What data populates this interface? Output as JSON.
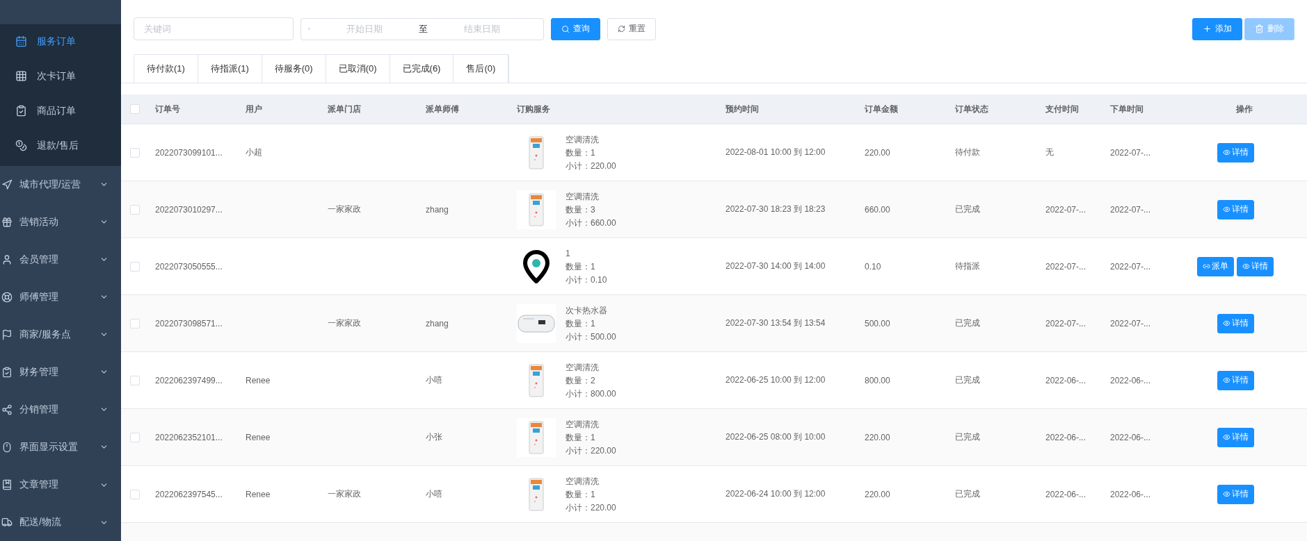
{
  "sidebar": {
    "submenu": [
      {
        "label": "服务订单",
        "selected": true
      },
      {
        "label": "次卡订单",
        "selected": false
      },
      {
        "label": "商品订单",
        "selected": false
      },
      {
        "label": "退款/售后",
        "selected": false
      }
    ],
    "items": [
      {
        "label": "城市代理/运营"
      },
      {
        "label": "营销活动"
      },
      {
        "label": "会员管理"
      },
      {
        "label": "师傅管理"
      },
      {
        "label": "商家/服务点"
      },
      {
        "label": "财务管理"
      },
      {
        "label": "分销管理"
      },
      {
        "label": "界面显示设置"
      },
      {
        "label": "文章管理"
      },
      {
        "label": "配送/物流"
      }
    ]
  },
  "filters": {
    "keyword": {
      "placeholder": "关键词"
    },
    "date_range": {
      "start_placeholder": "开始日期",
      "separator": "至",
      "end_placeholder": "结束日期"
    },
    "search_button": "查询",
    "reset_button": "重置"
  },
  "actions": [
    {
      "label": "添加",
      "kind": "add",
      "disabled": false
    },
    {
      "label": "删除",
      "kind": "delete",
      "disabled": true
    }
  ],
  "tabs": [
    {
      "label": "待付款(1)",
      "selected": false
    },
    {
      "label": "待指派(1)",
      "selected": false
    },
    {
      "label": "待服务(0)",
      "selected": false
    },
    {
      "label": "已取消(0)",
      "selected": false
    },
    {
      "label": "已完成(6)",
      "selected": false
    },
    {
      "label": "售后(0)",
      "selected": false
    }
  ],
  "table": {
    "select_all": {
      "checked": false
    },
    "columns": [
      "订单号",
      "用户",
      "派单门店",
      "派单师傅",
      "订购服务",
      "预约时间",
      "订单金额",
      "订单状态",
      "支付时间",
      "下单时间",
      "操作"
    ],
    "rows": [
      {
        "checked": false,
        "order_no": "2022073099101...",
        "user": "小超",
        "store": "",
        "worker": "",
        "service": {
          "kind": "ac",
          "name": "空调清洗",
          "qty": "数量：1",
          "subtotal": "小计：220.00"
        },
        "appointment": "2022-08-01 10:00 到 12:00",
        "amount": "220.00",
        "status": "待付款",
        "pay_time": "无",
        "order_time": "2022-07-...",
        "buttons": [
          {
            "kind": "detail",
            "label": "详情"
          }
        ]
      },
      {
        "checked": false,
        "order_no": "2022073010297...",
        "user": "",
        "store": "一家家政",
        "worker": "zhang",
        "service": {
          "kind": "ac",
          "name": "空调清洗",
          "qty": "数量：3",
          "subtotal": "小计：660.00"
        },
        "appointment": "2022-07-30 18:23 到 18:23",
        "amount": "660.00",
        "status": "已完成",
        "pay_time": "2022-07-...",
        "order_time": "2022-07-...",
        "buttons": [
          {
            "kind": "detail",
            "label": "详情"
          }
        ]
      },
      {
        "checked": false,
        "order_no": "2022073050555...",
        "user": "",
        "store": "",
        "worker": "",
        "service": {
          "kind": "pin",
          "name": "1",
          "qty": "数量：1",
          "subtotal": "小计：0.10"
        },
        "appointment": "2022-07-30 14:00 到 14:00",
        "amount": "0.10",
        "status": "待指派",
        "pay_time": "2022-07-...",
        "order_time": "2022-07-...",
        "buttons": [
          {
            "kind": "dispatch",
            "label": "派单"
          },
          {
            "kind": "detail",
            "label": "详情"
          }
        ]
      },
      {
        "checked": false,
        "order_no": "2022073098571...",
        "user": "",
        "store": "一家家政",
        "worker": "zhang",
        "service": {
          "kind": "heater",
          "name": "次卡热水器",
          "qty": "数量：1",
          "subtotal": "小计：500.00"
        },
        "appointment": "2022-07-30 13:54 到 13:54",
        "amount": "500.00",
        "status": "已完成",
        "pay_time": "2022-07-...",
        "order_time": "2022-07-...",
        "buttons": [
          {
            "kind": "detail",
            "label": "详情"
          }
        ]
      },
      {
        "checked": false,
        "order_no": "2022062397499...",
        "user": "Renee",
        "store": "",
        "worker": "小嘻",
        "service": {
          "kind": "ac",
          "name": "空调清洗",
          "qty": "数量：2",
          "subtotal": "小计：800.00"
        },
        "appointment": "2022-06-25 10:00 到 12:00",
        "amount": "800.00",
        "status": "已完成",
        "pay_time": "2022-06-...",
        "order_time": "2022-06-...",
        "buttons": [
          {
            "kind": "detail",
            "label": "详情"
          }
        ]
      },
      {
        "checked": false,
        "order_no": "2022062352101...",
        "user": "Renee",
        "store": "",
        "worker": "小张",
        "service": {
          "kind": "ac",
          "name": "空调清洗",
          "qty": "数量：1",
          "subtotal": "小计：220.00"
        },
        "appointment": "2022-06-25 08:00 到 10:00",
        "amount": "220.00",
        "status": "已完成",
        "pay_time": "2022-06-...",
        "order_time": "2022-06-...",
        "buttons": [
          {
            "kind": "detail",
            "label": "详情"
          }
        ]
      },
      {
        "checked": false,
        "order_no": "2022062397545...",
        "user": "Renee",
        "store": "一家家政",
        "worker": "小嘻",
        "service": {
          "kind": "ac",
          "name": "空调清洗",
          "qty": "数量：1",
          "subtotal": "小计：220.00"
        },
        "appointment": "2022-06-24 10:00 到 12:00",
        "amount": "220.00",
        "status": "已完成",
        "pay_time": "2022-06-...",
        "order_time": "2022-06-...",
        "buttons": [
          {
            "kind": "detail",
            "label": "详情"
          }
        ]
      }
    ]
  }
}
